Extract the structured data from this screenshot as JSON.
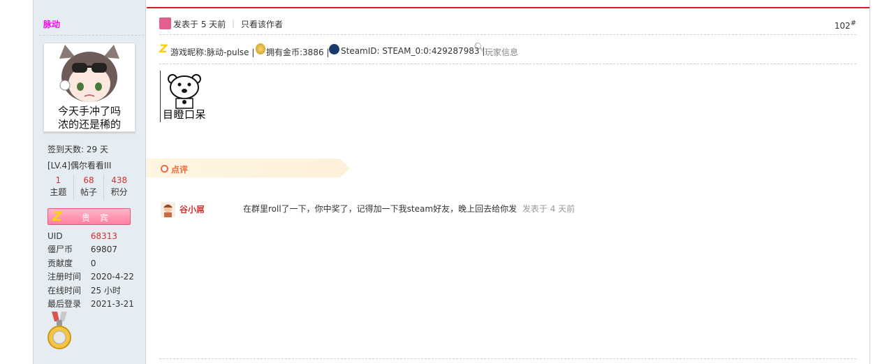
{
  "sidebar": {
    "username": "脉动",
    "avatar_caption_line1": "今天手冲了吗",
    "avatar_caption_line2": "浓的还是稀的",
    "sign_days": "签到天数: 29 天",
    "level": "[LV.4]偶尔看看III",
    "stats": [
      {
        "value": "1",
        "label": "主题"
      },
      {
        "value": "68",
        "label": "帖子"
      },
      {
        "value": "438",
        "label": "积分"
      }
    ],
    "vip_label": "贵宾",
    "info": [
      {
        "key": "UID",
        "value": "68313"
      },
      {
        "key": "僵尸币",
        "value": "69807"
      },
      {
        "key": "贡献度",
        "value": "0"
      },
      {
        "key": "注册时间",
        "value": "2020-4-22"
      },
      {
        "key": "在线时间",
        "value": "25 小时"
      },
      {
        "key": "最后登录",
        "value": "2021-3-21"
      }
    ]
  },
  "post": {
    "time": "发表于 5 天前",
    "separator": "|",
    "only_author": "只看该作者",
    "floor": "102",
    "floor_suffix": "#",
    "game_nick": "游戏昵称:脉动-pulse |",
    "coins": "拥有金币:3886 |",
    "steam_id": "SteamID: STEAM_0:0:429287983 |",
    "player_info": "玩家信息",
    "sticker_caption": "目瞪口呆"
  },
  "comments": {
    "title": "点评",
    "items": [
      {
        "author": "谷小屌",
        "text": "在群里roll了一下，你中奖了，记得加一下我steam好友，晚上回去给你发",
        "time": "发表于 4 天前"
      }
    ]
  },
  "colors": {
    "sidebar_bg": "#e5edf2",
    "accent_red": "#cc2222",
    "username": "#ff00ff",
    "comment_accent": "#ee6a3a"
  }
}
